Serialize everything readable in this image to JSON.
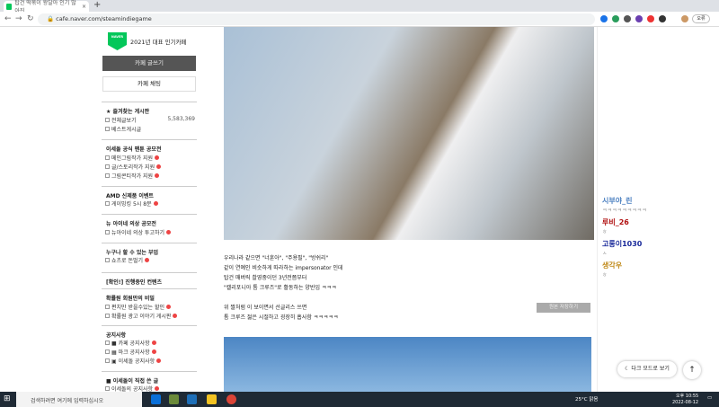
{
  "browser": {
    "tab_title": "탑건 떡볶이 왕달아 인기 많아진",
    "url": "cafe.naver.com/steamindiegame",
    "profile": "오류"
  },
  "sidebar": {
    "logo": "NAVER 대표카페",
    "award": "2021년 대표 인기카페",
    "write": "카페 글쓰기",
    "chat": "카페 채팅",
    "sections": [
      {
        "title": "★ 즐겨찾는 게시판",
        "items": [
          {
            "label": "전체글보기",
            "count": "5,583,369"
          },
          {
            "label": "베스트게시글"
          }
        ]
      },
      {
        "title": "이세돌 공식 팬툰 공모전",
        "items": [
          {
            "label": "메인그림작가 지원"
          },
          {
            "label": "글/스토리작가 지원"
          },
          {
            "label": "그림콘티작가 지원"
          }
        ]
      },
      {
        "title": "AMD 신제품 이벤트",
        "items": [
          {
            "label": "게이밍킹 5시 8분"
          }
        ]
      },
      {
        "title": "뉴 아이네 의상 공모전",
        "items": [
          {
            "label": "뉴아이네 의상 투고하기"
          }
        ]
      },
      {
        "title": "누구나 할 수 있는 부업",
        "items": [
          {
            "label": "쇼츠로 돈벌기"
          }
        ]
      },
      {
        "title": "[확인!] 진행중인 컨텐츠",
        "items": []
      },
      {
        "title": "확률원 회원만의 비밀",
        "items": [
          {
            "label": "편치만 받을수있는 할인"
          },
          {
            "label": "확률원 광고 이야기 게시판"
          }
        ]
      },
      {
        "title": "공지사항",
        "items": [
          {
            "label": "■ 카페 공지사항"
          },
          {
            "label": "▦ 마크 공지사항"
          },
          {
            "label": "▣ 이세돌 공지사항"
          }
        ]
      },
      {
        "title": "■ 이세돌이 직접 쓴 글",
        "items": [
          {
            "label": "이세돌의 공지사항"
          }
        ]
      }
    ]
  },
  "post": {
    "lines": [
      "우리나라 같으면 \"너훈아\", \"주용필\", \"방쉬리\"",
      "같이 연예인 비슷하게 따라하는 impersonator 인데",
      "탑건 매버릭 촬영중이던 3년전쯤부터",
      "\"캘리포니아 톰 크루즈\"로 활동하는 양반임 ㅋㅋㅋ",
      "위 짤처럼 이 보이면서 선글리스 쓰면",
      "톰 크루즈 젊은 시절하고 굉장히 흡사함 ㅋㅋㅋㅋㅋ"
    ],
    "save_original": "원본 저장하기"
  },
  "chat": [
    {
      "name": "시부야_린",
      "msg": "ㅋㅋㅋㅋㅋㅋㅋㅋㅋ",
      "color": "#4a7fc0"
    },
    {
      "name": "루비_26",
      "msg": "ㅎ",
      "color": "#b01010"
    },
    {
      "name": "고롱이1030",
      "msg": "ㅅ",
      "color": "#1a2a9a"
    },
    {
      "name": "생각우",
      "msg": "ㅎ",
      "color": "#c08a1a"
    }
  ],
  "dark_mode": "다크 모드로 보기",
  "taskbar": {
    "search": "검색하려면 여기에 입력하십시오",
    "weather": "25°C 맑음",
    "time": "오후 10:55",
    "date": "2022-08-12"
  }
}
